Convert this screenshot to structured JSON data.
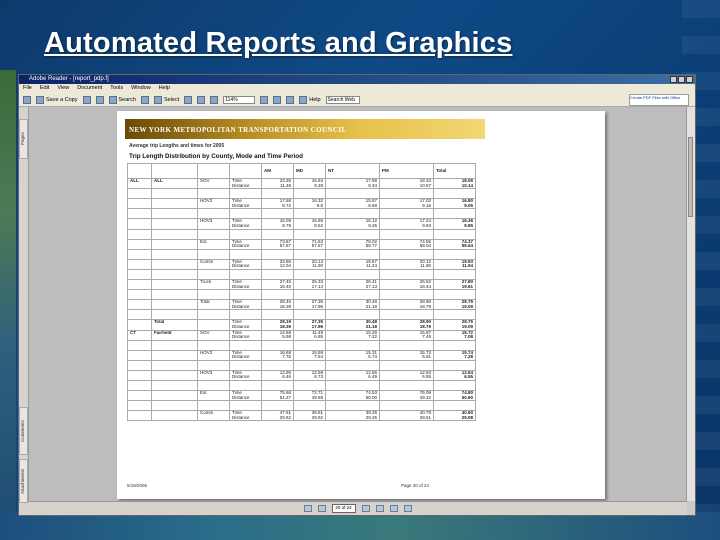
{
  "slide": {
    "title": "Automated Reports and Graphics"
  },
  "window": {
    "title": "Adobe Reader - [report_pdp.f]",
    "menu": [
      "File",
      "Edit",
      "View",
      "Document",
      "Tools",
      "Window",
      "Help"
    ],
    "toolbar": {
      "save_copy": "Save a Copy",
      "search": "Search",
      "select": "Select",
      "zoom": "114%",
      "help": "Help",
      "search_field": "Search Web",
      "ad_text": "Create PDF Files with Office"
    },
    "left_tabs": [
      "Pages",
      "Comments",
      "Attachments"
    ],
    "status": {
      "page": "20 of 24"
    }
  },
  "document": {
    "banner": "NEW YORK METROPOLITAN TRANSPORTATION COUNCIL",
    "subtitle": "Average trip Lengths and times for 2005",
    "heading": "Trip Length Distribution by County, Mode and Time Period",
    "columns": [
      "AM",
      "MD",
      "NT",
      "PM",
      "Total"
    ],
    "row_labels": {
      "time": "Time",
      "distance": "Distance"
    },
    "sections": [
      {
        "county": "ALL",
        "county2": "ALL",
        "modes": [
          {
            "mode": "SOV",
            "time": [
              "23.35",
              "16.64",
              "17.59",
              "18.33",
              "18.09"
            ],
            "dist": [
              "11.48",
              "9.28",
              "9.34",
              "10.57",
              "10.14"
            ]
          },
          {
            "mode": "HOV2",
            "time": [
              "17.58",
              "16.32",
              "15.87",
              "17.02",
              "16.80"
            ],
            "dist": [
              "8.72",
              "9.8",
              "8.58",
              "9.16",
              "9.05"
            ]
          },
          {
            "mode": "HOV3",
            "time": [
              "16.08",
              "16.66",
              "16.12",
              "17.24",
              "16.36"
            ],
            "dist": [
              "8.78",
              "8.52",
              "9.25",
              "9.93",
              "9.85"
            ]
          },
          {
            "mode": "Ext.",
            "time": [
              "73.67",
              "71.53",
              "78.02",
              "74.55",
              "74.37"
            ],
            "dist": [
              "57.87",
              "57.67",
              "58.77",
              "58.04",
              "58.64"
            ]
          },
          {
            "mode": "Comm",
            "time": [
              "23.60",
              "20.13",
              "19.57",
              "20.12",
              "19.93"
            ],
            "dist": [
              "12.04",
              "11.90",
              "11.24",
              "11.90",
              "11.94"
            ]
          },
          {
            "mode": "Truck",
            "time": [
              "27.45",
              "26.33",
              "26.41",
              "26.52",
              "27.80"
            ],
            "dist": [
              "15.40",
              "17.13",
              "27.13",
              "18.44",
              "19.61"
            ]
          },
          {
            "mode": "Total",
            "time": [
              "28.45",
              "27.35",
              "30.48",
              "28.90",
              "28.75"
            ],
            "dist": [
              "18.39",
              "17.96",
              "21.18",
              "18.79",
              "19.09"
            ]
          }
        ],
        "total": {
          "label": "Total",
          "time": [
            "28.19",
            "27.35",
            "30.48",
            "28.90",
            "28.75"
          ],
          "dist": [
            "18.39",
            "17.96",
            "21.18",
            "18.79",
            "19.09"
          ]
        }
      },
      {
        "county": "CT",
        "county2": "Fairfield",
        "modes": [
          {
            "mode": "SOV",
            "time": [
              "14.58",
              "11.49",
              "15.29",
              "15.97",
              "15.72"
            ],
            "dist": [
              "5.98",
              "6.85",
              "7.22",
              "7.49",
              "7.08"
            ]
          },
          {
            "mode": "HOV2",
            "time": [
              "16.68",
              "15.59",
              "15.31",
              "15.72",
              "15.74"
            ],
            "dist": [
              "7.76",
              "7.54",
              "6.74",
              "6.91",
              "7.28"
            ]
          },
          {
            "mode": "HOV3",
            "time": [
              "12.95",
              "12.59",
              "12.55",
              "12.93",
              "12.64"
            ],
            "dist": [
              "6.46",
              "6.73",
              "6.49",
              "6.55",
              "6.55"
            ]
          },
          {
            "mode": "Ext",
            "time": [
              "75.66",
              "72.71",
              "74.53",
              "76.09",
              "74.80"
            ],
            "dist": [
              "51.27",
              "49.59",
              "50.00",
              "49.32",
              "50.60"
            ]
          },
          {
            "mode": "Comm",
            "time": [
              "47.81",
              "39.81",
              "39.25",
              "40.79",
              "40.60"
            ],
            "dist": [
              "29.82",
              "29.92",
              "29.25",
              "28.51",
              "29.08"
            ]
          }
        ]
      }
    ],
    "footer_left": "5/18/2005",
    "footer_right": "Page 20 of 24"
  }
}
